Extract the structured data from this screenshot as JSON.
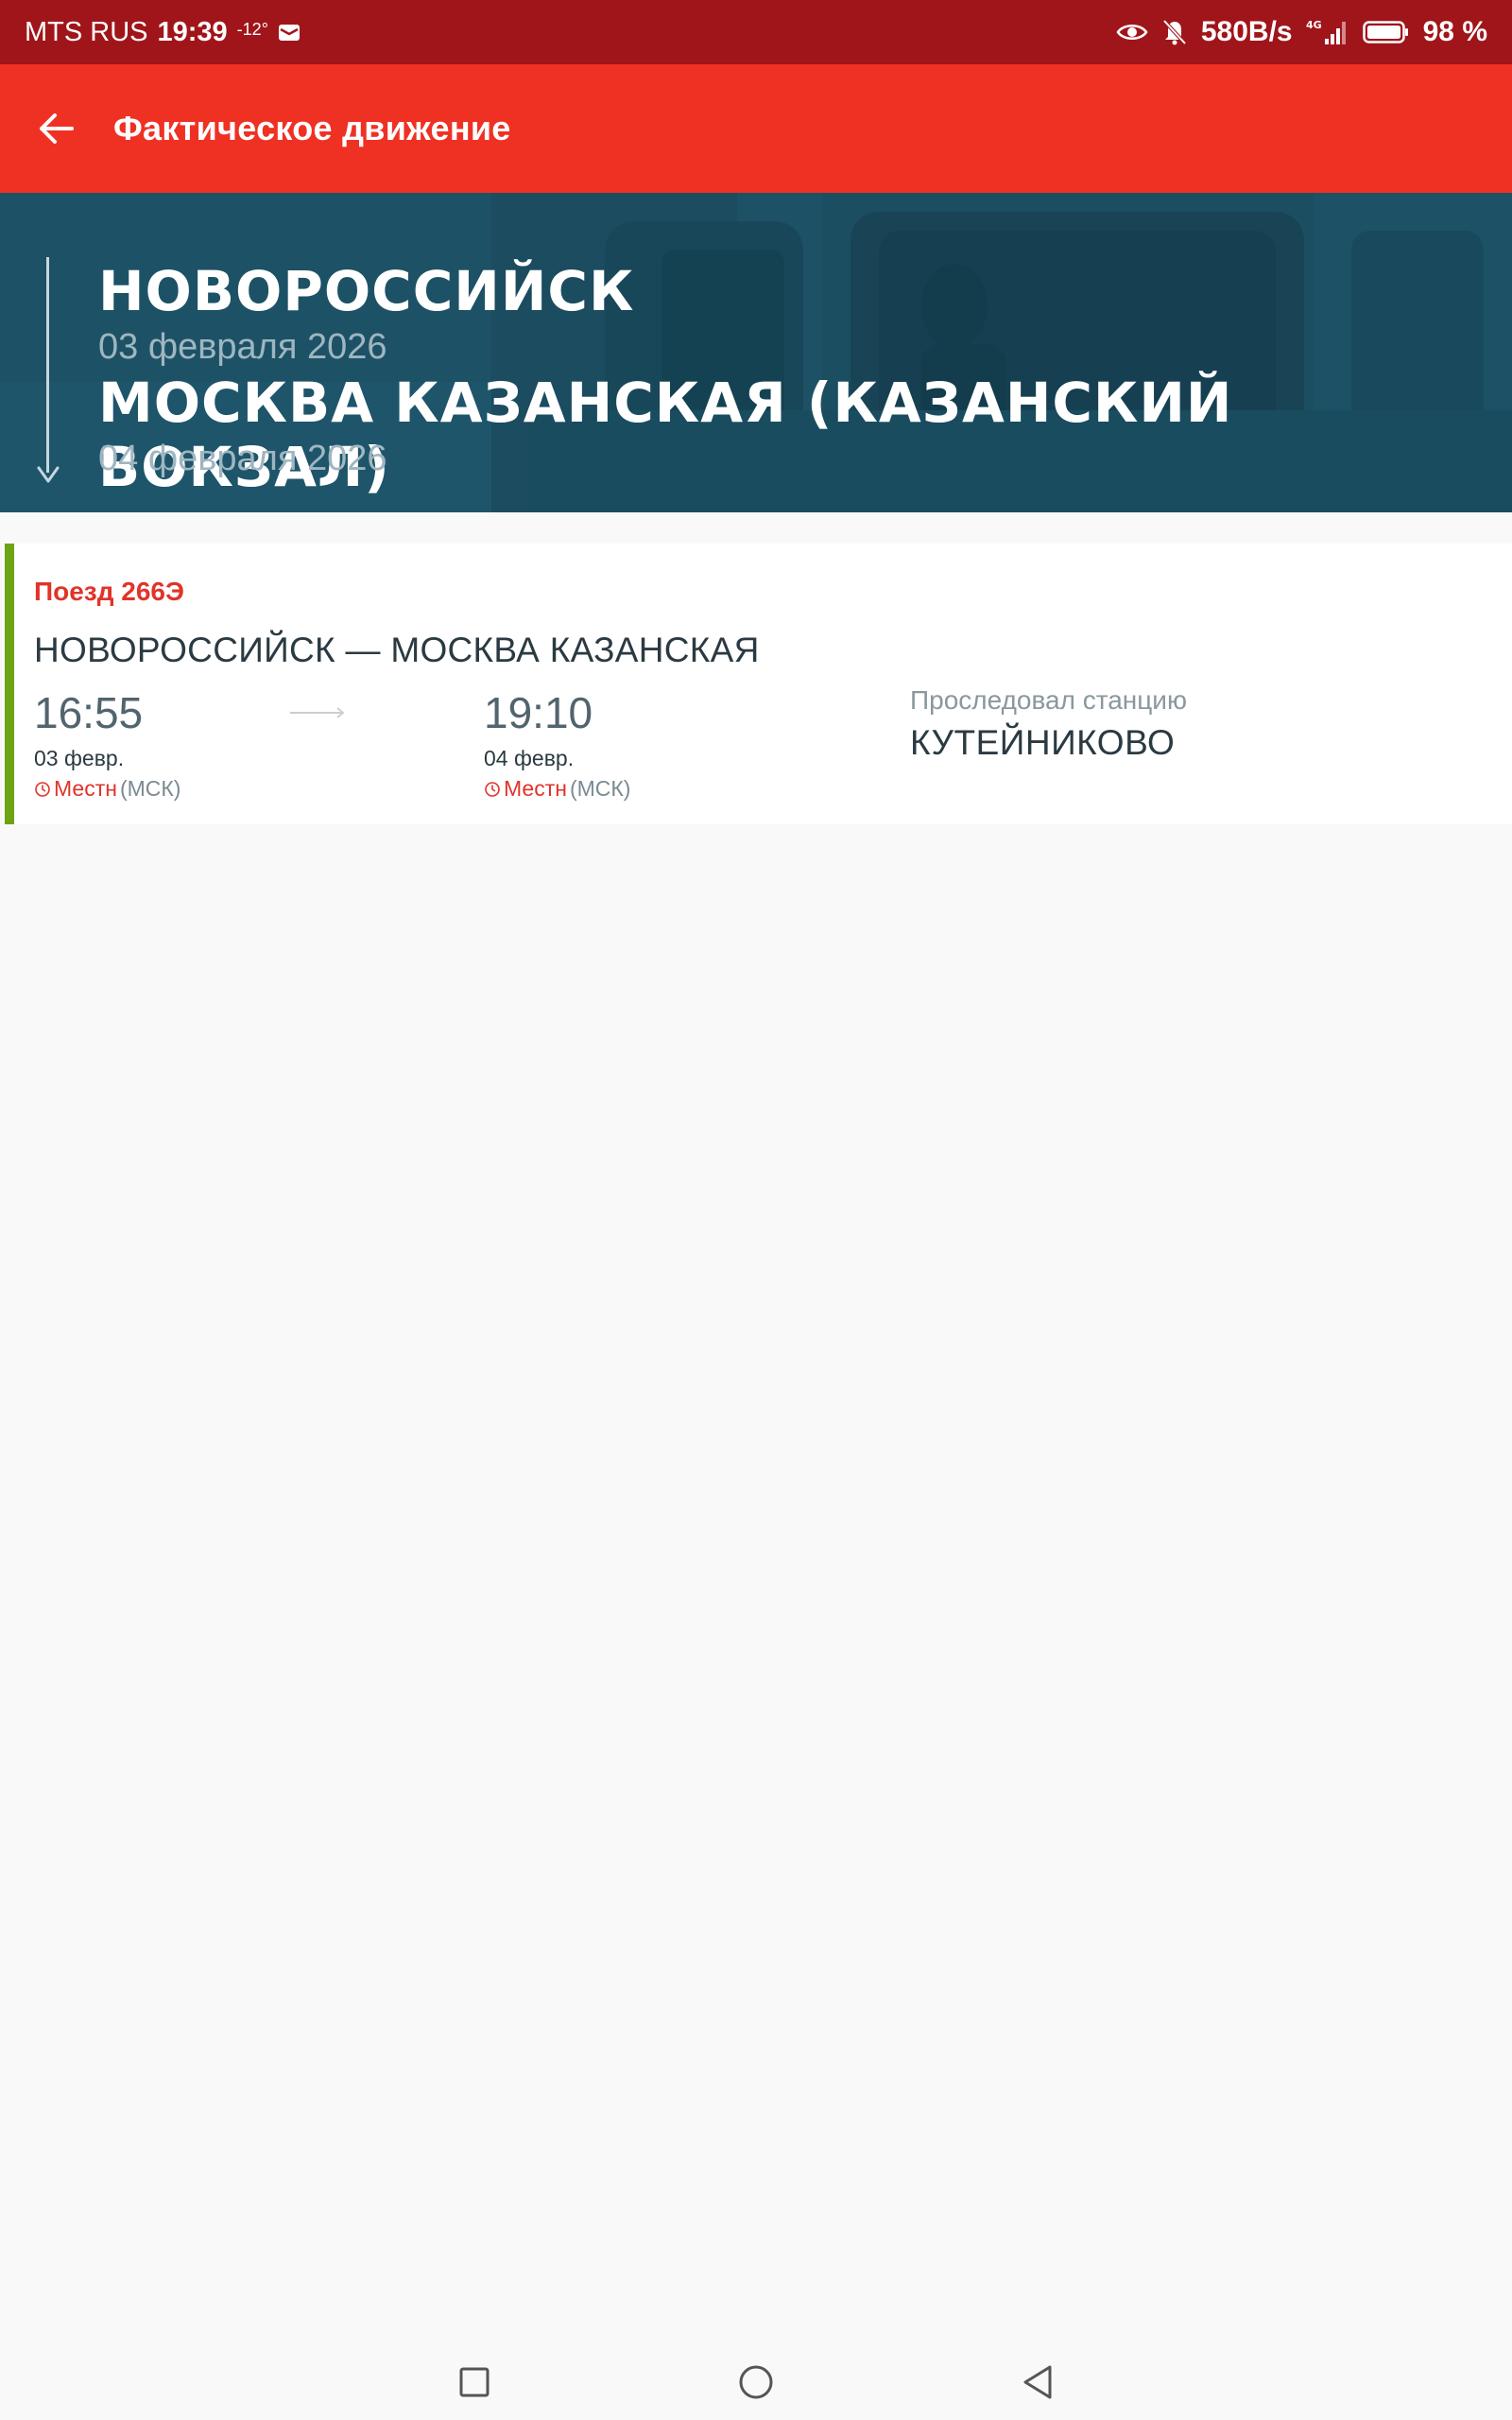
{
  "status_bar": {
    "carrier": "MTS RUS",
    "time": "19:39",
    "temperature": "-12°",
    "network_speed": "580B/s",
    "network_type": "4G",
    "battery": "98 %"
  },
  "app_bar": {
    "title": "Фактическое движение"
  },
  "hero": {
    "from_station": "НОВОРОССИЙСК",
    "from_date": "03 февраля 2026",
    "to_station": "МОСКВА КАЗАНСКАЯ (КАЗАНСКИЙ ВОКЗАЛ)",
    "to_date": "04 февраля 2026"
  },
  "train": {
    "number_label": "Поезд 266Э",
    "route": "НОВОРОССИЙСК — МОСКВА КАЗАНСКАЯ",
    "departure_time": "16:55",
    "departure_date": "03 февр.",
    "arrival_time": "19:10",
    "arrival_date": "04 февр.",
    "tz_local_label": "Местн",
    "tz_msk_label": "(МСК)",
    "passed_label": "Проследовал станцию",
    "passed_station": "КУТЕЙНИКОВО"
  },
  "colors": {
    "status_bar": "#a0151a",
    "app_bar": "#ef3124",
    "accent_green": "#6ea314",
    "accent_red": "#e0342a"
  }
}
